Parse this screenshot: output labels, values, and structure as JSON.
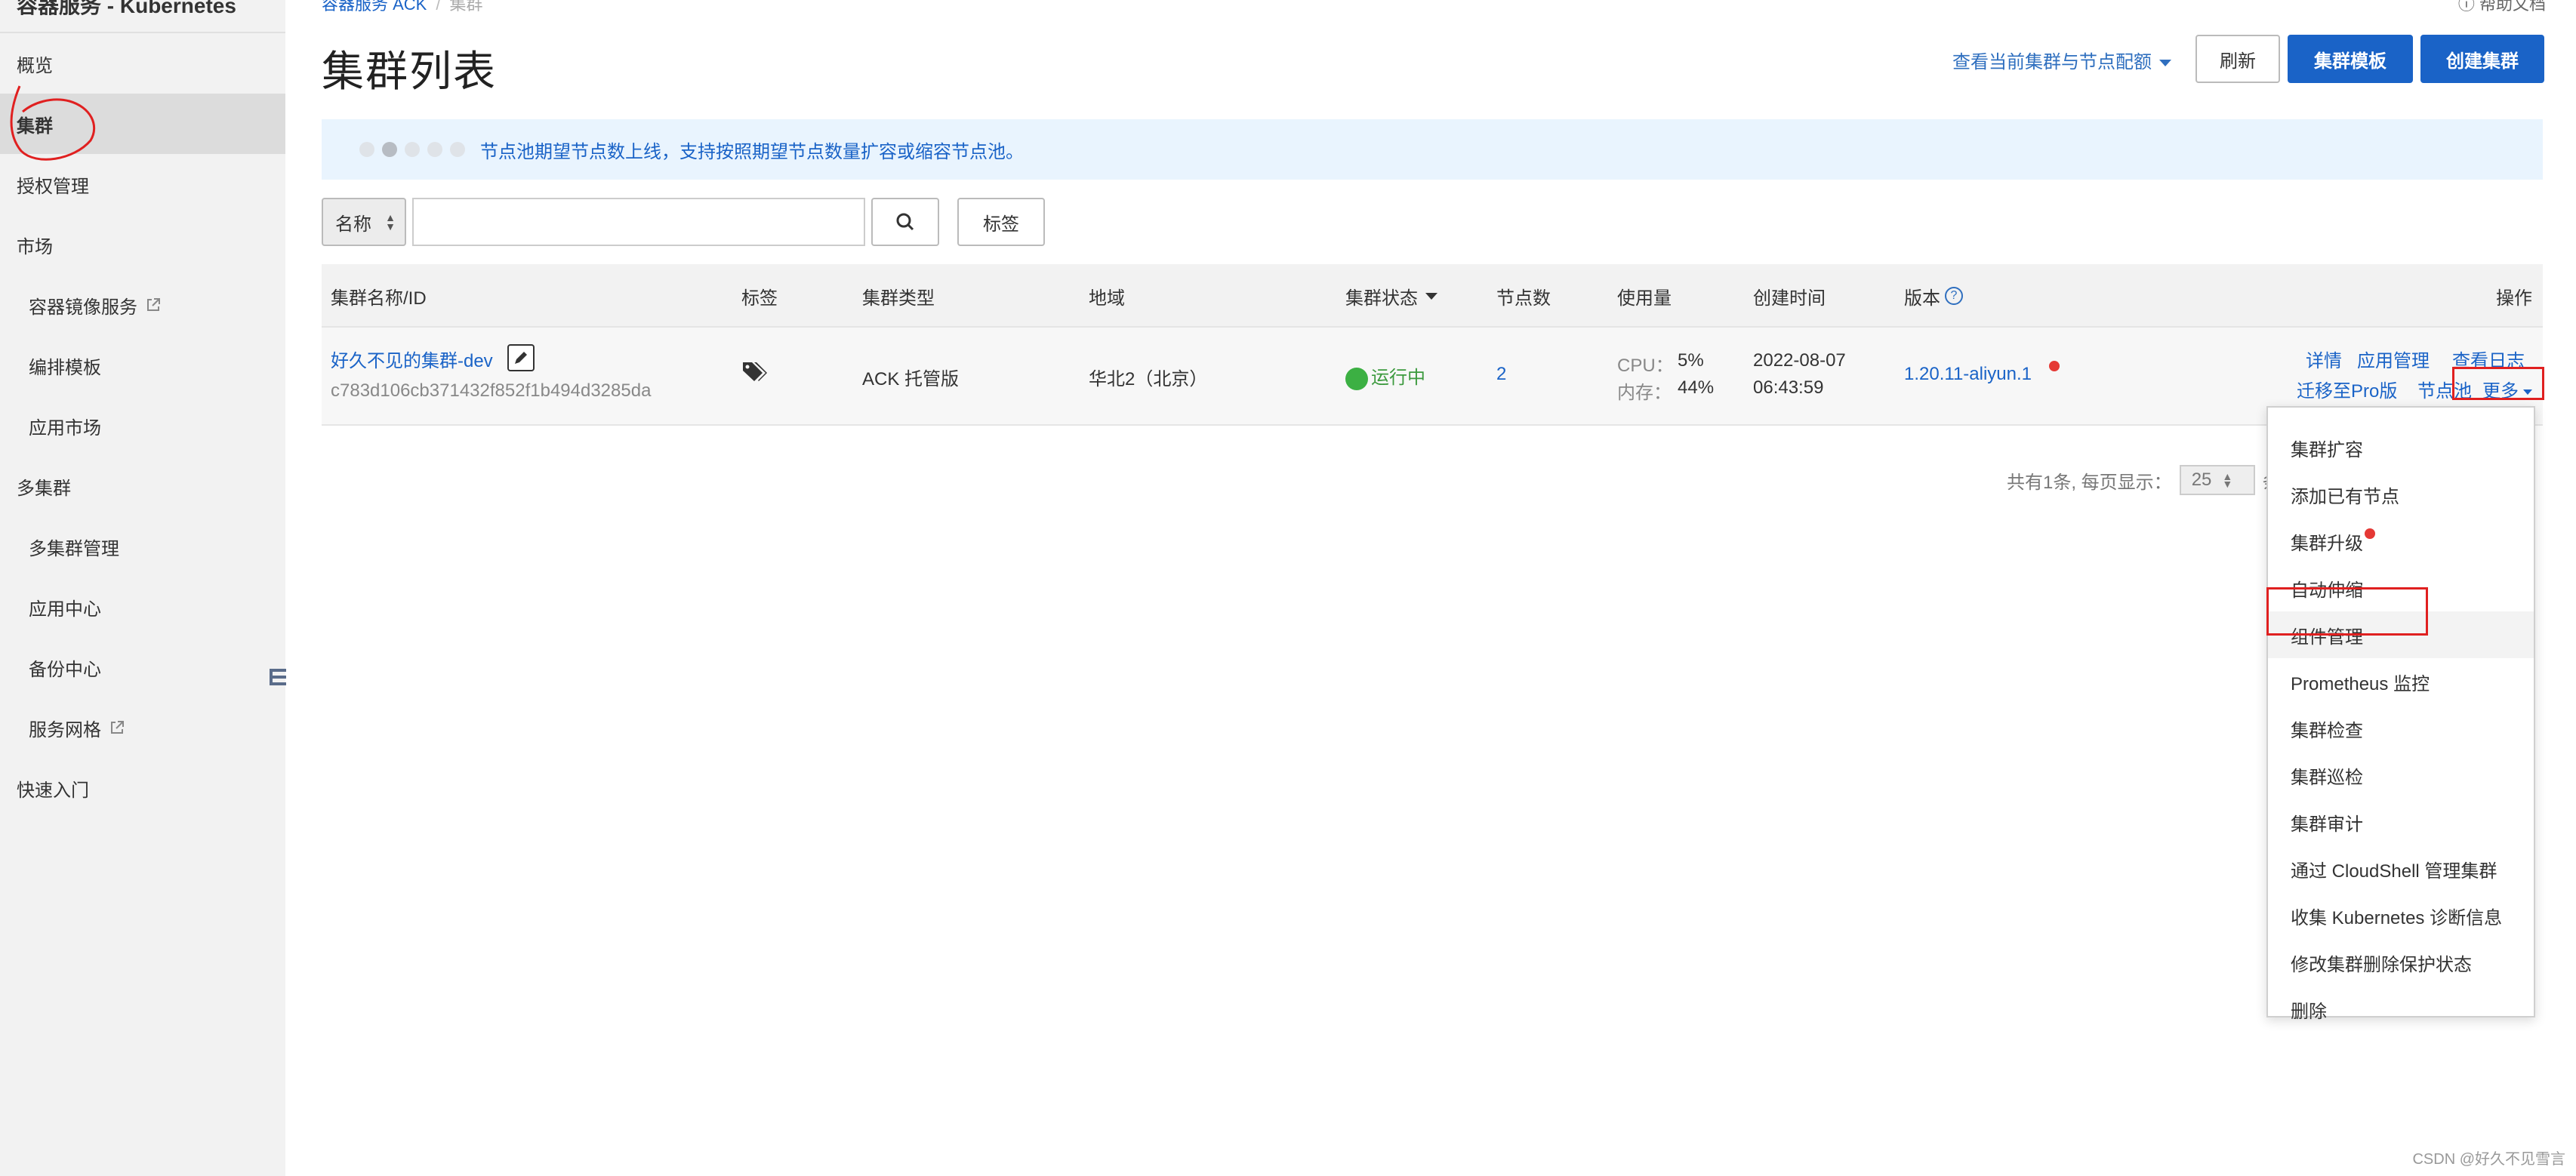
{
  "sidebar": {
    "title": "容器服务 - Kubernetes",
    "items": [
      {
        "label": "概览"
      },
      {
        "label": "集群"
      },
      {
        "label": "授权管理"
      },
      {
        "label": "市场"
      },
      {
        "label": "容器镜像服务"
      },
      {
        "label": "编排模板"
      },
      {
        "label": "应用市场"
      },
      {
        "label": "多集群"
      },
      {
        "label": "多集群管理"
      },
      {
        "label": "应用中心"
      },
      {
        "label": "备份中心"
      },
      {
        "label": "服务网格"
      },
      {
        "label": "快速入门"
      }
    ]
  },
  "header": {
    "breadcrumb": [
      "容器服务 ACK",
      "集群"
    ],
    "help": "帮助文档",
    "title": "集群列表",
    "view_quota": "查看当前集群与节点配额",
    "refresh": "刷新",
    "template": "集群模板",
    "create": "创建集群"
  },
  "notice": {
    "text": "节点池期望节点数上线，支持按照期望节点数量扩容或缩容节点池。"
  },
  "filter": {
    "select_value": "名称",
    "input_value": "",
    "tag_button": "标签"
  },
  "table": {
    "columns": [
      "集群名称/ID",
      "标签",
      "集群类型",
      "地域",
      "集群状态",
      "节点数",
      "使用量",
      "创建时间",
      "版本",
      "操作"
    ],
    "row": {
      "name": "好久不见的集群-dev",
      "id": "c783d106cb371432f852f1b494d3285da",
      "type": "ACK 托管版",
      "region": "华北2（北京）",
      "status": "运行中",
      "nodes": "2",
      "cpu_label": "CPU：",
      "cpu_value": "5%",
      "mem_label": "内存：",
      "mem_value": "44%",
      "created_date": "2022-08-07",
      "created_time": "06:43:59",
      "version": "1.20.11-aliyun.1",
      "actions": {
        "detail": "详情",
        "app_manage": "应用管理",
        "logs": "查看日志",
        "migrate": "迁移至Pro版",
        "nodepool": "节点池",
        "more": "更多"
      }
    }
  },
  "pagination": {
    "total": "共有1条, 每页显示：",
    "page_size": "25",
    "trailing": "条"
  },
  "more_menu": [
    "集群扩容",
    "添加已有节点",
    "集群升级",
    "自动伸缩",
    "组件管理",
    "Prometheus 监控",
    "集群检查",
    "集群巡检",
    "集群审计",
    "通过 CloudShell 管理集群",
    "收集 Kubernetes 诊断信息",
    "修改集群删除保护状态",
    "删除"
  ],
  "watermark": "CSDN @好久不见雪言",
  "colors": {
    "primary": "#1a63c7",
    "link": "#1a63c7",
    "running": "#3cb043",
    "annotation": "#e02020",
    "notice_bg": "#e9f4fe"
  }
}
